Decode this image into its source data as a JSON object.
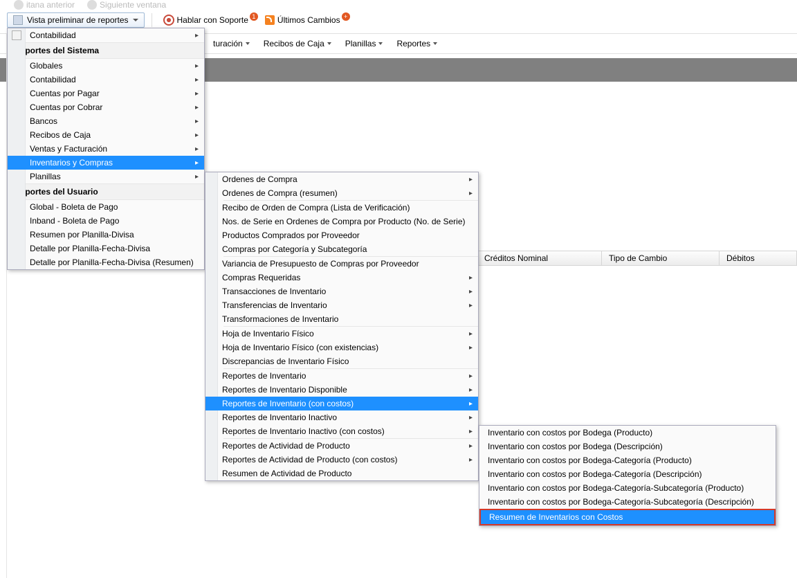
{
  "top_hints": {
    "prev": "itana anterior",
    "next": "Siguiente ventana"
  },
  "toolbar": {
    "preview": "Vista preliminar de reportes",
    "support": "Hablar con Soporte",
    "support_badge": "1",
    "changes": "Últimos Cambios",
    "changes_badge": "+"
  },
  "menu_row": {
    "facturacion": "turación",
    "recibos": "Recibos de Caja",
    "planillas": "Planillas",
    "reportes": "Reportes"
  },
  "columns": {
    "creditos": "Créditos Nominal",
    "tipo": "Tipo de Cambio",
    "debitos": "Débitos"
  },
  "menu1": {
    "contabilidad_top": "Contabilidad",
    "head_sistema": "Reportes del Sistema",
    "globales": "Globales",
    "contabilidad": "Contabilidad",
    "cxp": "Cuentas por Pagar",
    "cxc": "Cuentas por Cobrar",
    "bancos": "Bancos",
    "recibos": "Recibos de Caja",
    "ventas": "Ventas y Facturación",
    "inventarios": "Inventarios y Compras",
    "planillas": "Planillas",
    "head_usuario": "Reportes del Usuario",
    "u1": "Global - Boleta de Pago",
    "u2": "Inband - Boleta de Pago",
    "u3": "Resumen por Planilla-Divisa",
    "u4": "Detalle por Planilla-Fecha-Divisa",
    "u5": "Detalle por Planilla-Fecha-Divisa (Resumen)"
  },
  "menu2": {
    "i01": "Ordenes de Compra",
    "i02": "Ordenes de Compra (resumen)",
    "i03": "Recibo de Orden de Compra (Lista de Verificación)",
    "i04": "Nos. de Serie en Ordenes de Compra por Producto (No. de Serie)",
    "i05": "Productos Comprados por Proveedor",
    "i06": "Compras por Categoría y Subcategoría",
    "i07": "Variancia de Presupuesto de Compras por Proveedor",
    "i08": "Compras Requeridas",
    "i09": "Transacciones de Inventario",
    "i10": "Transferencias de Inventario",
    "i11": "Transformaciones de Inventario",
    "i12": "Hoja de Inventario Físico",
    "i13": "Hoja de Inventario Físico (con existencias)",
    "i14": "Discrepancias de Inventario Físico",
    "i15": "Reportes de Inventario",
    "i16": "Reportes de Inventario Disponible",
    "i17": "Reportes de Inventario (con costos)",
    "i18": "Reportes de Inventario Inactivo",
    "i19": "Reportes de Inventario Inactivo (con costos)",
    "i20": "Reportes de Actividad de Producto",
    "i21": "Reportes de Actividad de Producto (con costos)",
    "i22": "Resumen de Actividad de Producto"
  },
  "menu3": {
    "j1": "Inventario con costos por Bodega (Producto)",
    "j2": "Inventario con costos por Bodega (Descripción)",
    "j3": "Inventario con costos por Bodega-Categoría (Producto)",
    "j4": "Inventario con costos por Bodega-Categoría (Descripción)",
    "j5": "Inventario con costos por Bodega-Categoría-Subcategoría (Producto)",
    "j6": "Inventario con costos por Bodega-Categoría-Subcategoría (Descripción)",
    "j7": "Resumen de Inventarios con Costos"
  }
}
